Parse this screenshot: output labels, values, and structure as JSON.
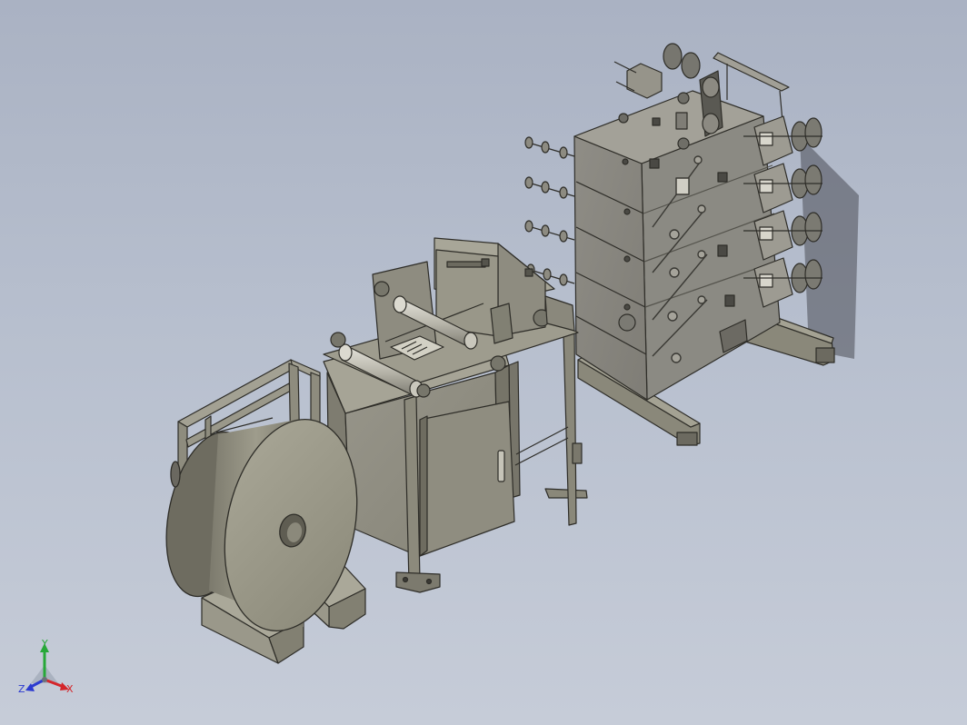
{
  "viewport": {
    "background_top": "#aab2c3",
    "background_bottom": "#c6ccd8"
  },
  "model": {
    "components": [
      "unwind-reel",
      "reel-cradle-blocks",
      "reel-stand-frame",
      "cutting-machine",
      "machine-cabinet",
      "cabinet-door",
      "roller-assembly",
      "tension-rack",
      "upper-pulleys",
      "side-bobbin-units",
      "guide-rods",
      "rack-base-rails"
    ],
    "colors": {
      "metal_light": "#9c9a8a",
      "metal_mid": "#8a887a",
      "metal_dark": "#6c6a60",
      "edge": "#2e2d28",
      "shadow": "#4a4c55"
    }
  },
  "triad": {
    "labels": {
      "x": "X",
      "y": "Y",
      "z": "Z"
    },
    "colors": {
      "x": "#d4262b",
      "y": "#27a838",
      "z": "#2c3bd0"
    }
  }
}
